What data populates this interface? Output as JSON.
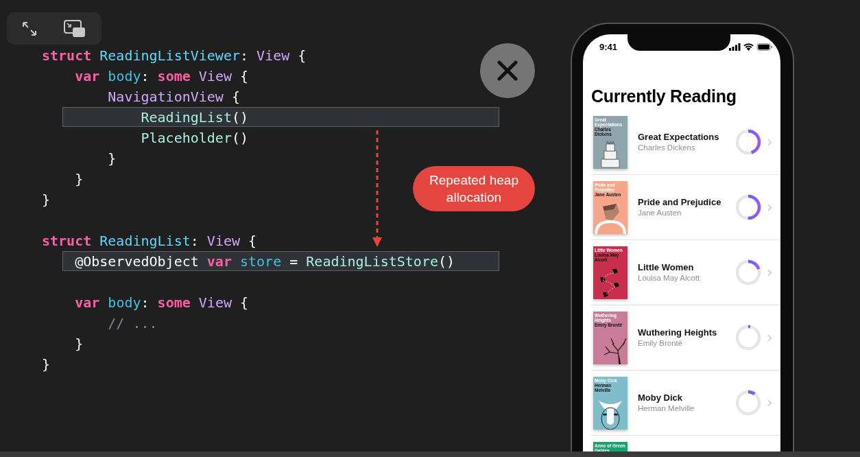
{
  "code": {
    "lines": [
      {
        "kind": "code",
        "highlighted": false,
        "tokens": [
          {
            "text": "struct",
            "kind": "keyword"
          },
          {
            "text": " ReadingListViewer",
            "kind": "declaration"
          },
          {
            "text": ": ",
            "kind": "plain"
          },
          {
            "text": "View",
            "kind": "type"
          },
          {
            "text": " {",
            "kind": "plain"
          }
        ]
      },
      {
        "kind": "code",
        "highlighted": false,
        "tokens": [
          {
            "text": "    var",
            "kind": "keyword"
          },
          {
            "text": " body",
            "kind": "property"
          },
          {
            "text": ": ",
            "kind": "plain"
          },
          {
            "text": "some",
            "kind": "keyword"
          },
          {
            "text": " View",
            "kind": "type"
          },
          {
            "text": " {",
            "kind": "plain"
          }
        ]
      },
      {
        "kind": "code",
        "highlighted": false,
        "tokens": [
          {
            "text": "        NavigationView",
            "kind": "type"
          },
          {
            "text": " {",
            "kind": "plain"
          }
        ]
      },
      {
        "kind": "code",
        "highlighted": true,
        "tokens": [
          {
            "text": "            ReadingList",
            "kind": "call"
          },
          {
            "text": "()",
            "kind": "plain"
          }
        ]
      },
      {
        "kind": "code",
        "highlighted": false,
        "tokens": [
          {
            "text": "            Placeholder",
            "kind": "call"
          },
          {
            "text": "()",
            "kind": "plain"
          }
        ]
      },
      {
        "kind": "code",
        "highlighted": false,
        "tokens": [
          {
            "text": "        }",
            "kind": "plain"
          }
        ]
      },
      {
        "kind": "code",
        "highlighted": false,
        "tokens": [
          {
            "text": "    }",
            "kind": "plain"
          }
        ]
      },
      {
        "kind": "code",
        "highlighted": false,
        "tokens": [
          {
            "text": "}",
            "kind": "plain"
          }
        ]
      },
      {
        "kind": "blank"
      },
      {
        "kind": "code",
        "highlighted": false,
        "tokens": [
          {
            "text": "struct",
            "kind": "keyword"
          },
          {
            "text": " ReadingList",
            "kind": "declaration"
          },
          {
            "text": ": ",
            "kind": "plain"
          },
          {
            "text": "View",
            "kind": "type"
          },
          {
            "text": " {",
            "kind": "plain"
          }
        ]
      },
      {
        "kind": "code",
        "highlighted": true,
        "tokens": [
          {
            "text": "    @ObservedObject ",
            "kind": "plain"
          },
          {
            "text": "var",
            "kind": "keyword"
          },
          {
            "text": " store",
            "kind": "property"
          },
          {
            "text": " = ",
            "kind": "plain"
          },
          {
            "text": "ReadingListStore",
            "kind": "call"
          },
          {
            "text": "()",
            "kind": "plain"
          }
        ]
      },
      {
        "kind": "blank"
      },
      {
        "kind": "code",
        "highlighted": false,
        "tokens": [
          {
            "text": "    var",
            "kind": "keyword"
          },
          {
            "text": " body",
            "kind": "property"
          },
          {
            "text": ": ",
            "kind": "plain"
          },
          {
            "text": "some",
            "kind": "keyword"
          },
          {
            "text": " View",
            "kind": "type"
          },
          {
            "text": " {",
            "kind": "plain"
          }
        ]
      },
      {
        "kind": "code",
        "highlighted": false,
        "tokens": [
          {
            "text": "        // ...",
            "kind": "comment"
          }
        ]
      },
      {
        "kind": "code",
        "highlighted": false,
        "tokens": [
          {
            "text": "    }",
            "kind": "plain"
          }
        ]
      },
      {
        "kind": "code",
        "highlighted": false,
        "tokens": [
          {
            "text": "}",
            "kind": "plain"
          }
        ]
      }
    ]
  },
  "callout": {
    "text": "Repeated heap allocation"
  },
  "phone": {
    "time": "9:41",
    "title": "Currently Reading",
    "books": [
      {
        "title": "Great Expectations",
        "author": "Charles Dickens",
        "cover_title": "Great Expectations",
        "cover_author": "Charles Dickens",
        "color": "#8fa5ae",
        "level": 0.45
      },
      {
        "title": "Pride and Prejudice",
        "author": "Jane Austen",
        "cover_title": "Pride and Prejudice",
        "cover_author": "Jane Austen",
        "color": "#f6a689",
        "level": 0.5
      },
      {
        "title": "Little Women",
        "author": "Louisa May Alcott",
        "cover_title": "Little Women",
        "cover_author": "Louisa May Alcott",
        "color": "#c92e4c",
        "level": 0.2
      },
      {
        "title": "Wuthering Heights",
        "author": "Emily Brontë",
        "cover_title": "Wuthering Heights",
        "cover_author": "Emily Brontë",
        "color": "#c87c98",
        "level": 0.03
      },
      {
        "title": "Moby Dick",
        "author": "Herman Melville",
        "cover_title": "Moby Dick",
        "cover_author": "Herman Melville",
        "color": "#80bdcb",
        "level": 0.1
      },
      {
        "cover_title": "Anne of Green Gables",
        "color": "#16a36c"
      }
    ]
  }
}
